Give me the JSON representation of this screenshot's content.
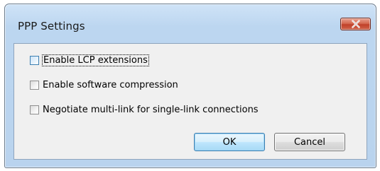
{
  "window": {
    "title": "PPP Settings",
    "close_icon": "close-icon"
  },
  "options": [
    {
      "label": "Enable LCP extensions",
      "checked": false,
      "focused": true
    },
    {
      "label": "Enable software compression",
      "checked": false,
      "focused": false
    },
    {
      "label": "Negotiate multi-link for single-link connections",
      "checked": false,
      "focused": false
    }
  ],
  "buttons": {
    "ok_label": "OK",
    "cancel_label": "Cancel"
  },
  "colors": {
    "title_bar": "#bcd6f0",
    "close_button": "#c0412a",
    "client_background": "#f0f0f0",
    "default_button_border": "#3c7fb1"
  }
}
